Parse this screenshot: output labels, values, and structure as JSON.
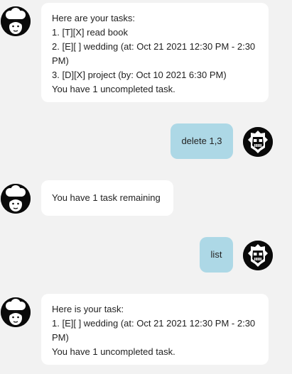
{
  "colors": {
    "background": "#f2f2f2",
    "bot_bubble": "#ffffff",
    "user_bubble": "#add8e6",
    "avatar_bg": "#0a0a0a"
  },
  "messages": [
    {
      "sender": "bot",
      "avatar_icon": "chef-avatar-icon",
      "lines": [
        "Here are your tasks:",
        "1. [T][X] read book",
        "2. [E][ ] wedding (at: Oct 21 2021 12:30 PM - 2:30",
        "PM)",
        "3. [D][X] project (by: Oct 10 2021 6:30 PM)",
        "You have 1 uncompleted task."
      ]
    },
    {
      "sender": "user",
      "avatar_icon": "masked-warrior-avatar-icon",
      "text": "delete 1,3"
    },
    {
      "sender": "bot",
      "avatar_icon": "chef-avatar-icon",
      "lines": [
        "You have 1 task remaining"
      ]
    },
    {
      "sender": "user",
      "avatar_icon": "masked-warrior-avatar-icon",
      "text": "list"
    },
    {
      "sender": "bot",
      "avatar_icon": "chef-avatar-icon",
      "lines": [
        "Here is your task:",
        "1. [E][ ] wedding (at: Oct 21 2021 12:30 PM - 2:30",
        "PM)",
        "You have 1 uncompleted task."
      ]
    }
  ]
}
